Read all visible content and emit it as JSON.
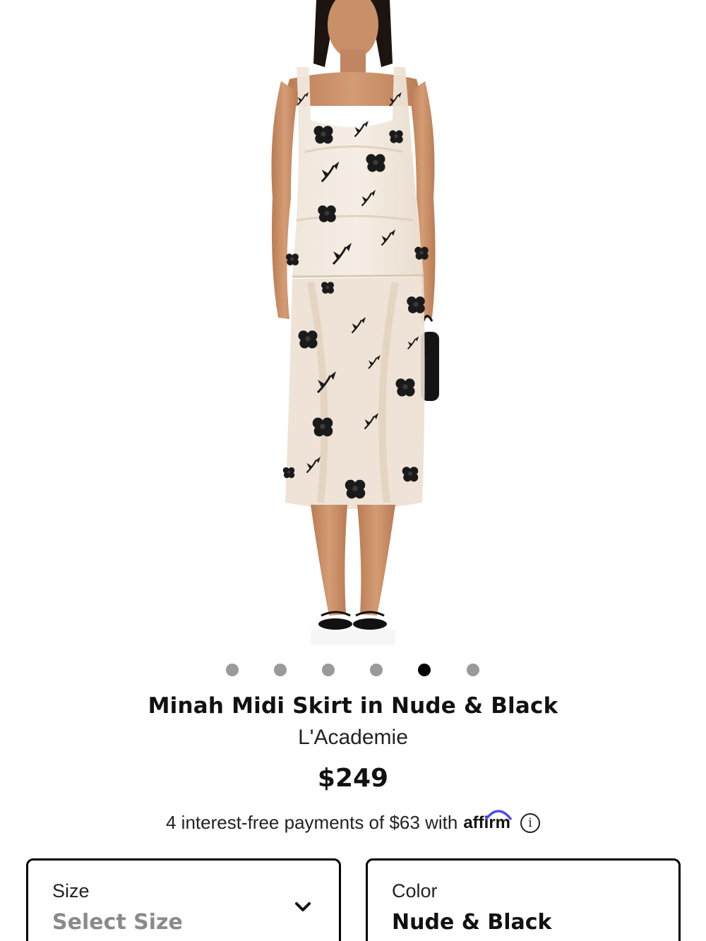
{
  "product": {
    "title": "Minah Midi Skirt in Nude & Black",
    "brand": "L'Academie",
    "price": "$249",
    "image_alt": "Model wearing sheer nude organza top and midi skirt with black floral appliqués"
  },
  "carousel": {
    "total_images": 6,
    "active_index": 4
  },
  "financing": {
    "text": "4 interest-free payments of $63 with",
    "provider": "affirm",
    "info_icon": "info-icon"
  },
  "size_selector": {
    "label": "Size",
    "value": "Select Size",
    "icon": "chevron-down-icon"
  },
  "color_selector": {
    "label": "Color",
    "value": "Nude & Black"
  },
  "colors": {
    "active_dot": "#000000",
    "inactive_dot": "#9a9a9a",
    "placeholder_text": "#8a8a8a",
    "fabric": "#efe4d6",
    "skin": "#c98f68",
    "appliqué": "#1a1a1a"
  }
}
